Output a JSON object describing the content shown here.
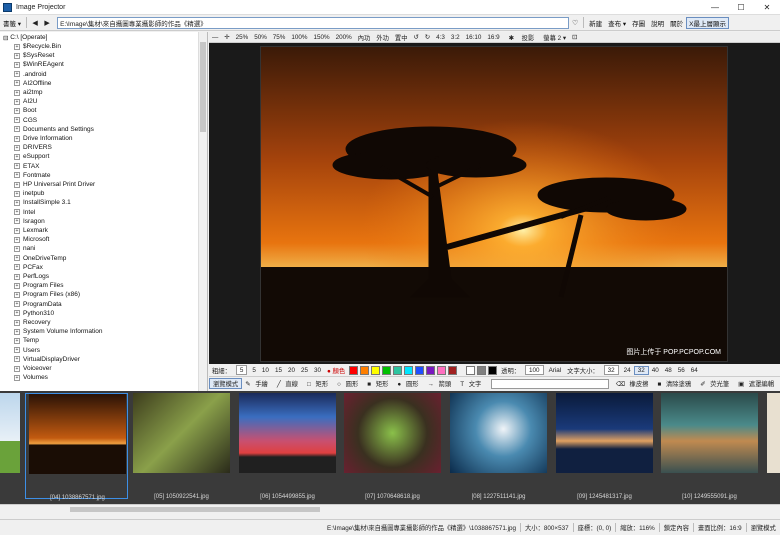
{
  "window": {
    "title": "Image Projector",
    "min": "—",
    "max": "☐",
    "close": "✕"
  },
  "toolbar": {
    "bookmarks": "書籤 ▾",
    "back": "◀",
    "forward": "▶",
    "address": "E:\\Image\\集材\\來自攝圖專業攝影師的作品《精選》",
    "items": [
      "新建",
      "查布 ▾",
      "存圖",
      "說明",
      "關於"
    ],
    "fullscreen": "X最上層顯示"
  },
  "viewer_toolbar": {
    "items": [
      "25%",
      "50%",
      "75%",
      "100%",
      "150%",
      "200%",
      "內功",
      "外功",
      "置中",
      "↺",
      "↻",
      "4:3",
      "3:2",
      "16:10",
      "16:9"
    ],
    "slideshow": "投影",
    "screen": "螢幕 2 ▾"
  },
  "tree": {
    "root": "C:\\ [Operate]",
    "items": [
      "$Recycle.Bin",
      "$SysReset",
      "$WinREAgent",
      ".android",
      "AI2Offline",
      "ai2tmp",
      "AI2U",
      "Boot",
      "CGS",
      "Documents and Settings",
      "Drive Information",
      "DRIVERS",
      "eSupport",
      "ETAX",
      "Fontmate",
      "HP Universal Print Driver",
      "inetpub",
      "InstallSimple 3.1",
      "Intel",
      "Isragon",
      "Lexmark",
      "Microsoft",
      "nani",
      "OneDriveTemp",
      "PCFax",
      "PerfLogs",
      "Program Files",
      "Program Files (x86)",
      "ProgramData",
      "Python310",
      "Recovery",
      "System Volume Information",
      "Temp",
      "Users",
      "VirtualDisplayDriver",
      "Voiceover",
      "Volumes"
    ]
  },
  "main_image": {
    "watermark": "图片上传于 POP.PCPOP.COM"
  },
  "drawbar": {
    "thickness_label": "粗細：",
    "thickness_value": "5",
    "sizes": [
      "5",
      "10",
      "15",
      "20",
      "25",
      "30"
    ],
    "color_label": "● 顏色",
    "colors": [
      "#ff0000",
      "#ff7f00",
      "#ffff00",
      "#00c000",
      "#2ec4a0",
      "#00e5ff",
      "#1f4fff",
      "#7a18c0",
      "#ff70c0",
      "#a02020",
      "#ffffff",
      "#808080",
      "#000000"
    ],
    "opacity_label": "透明：",
    "opacity_value": "100",
    "font": "Arial",
    "fontsize_label": "文字大小：",
    "fontsize_value": "32",
    "fontsizes": [
      "24",
      "32",
      "40",
      "48",
      "56",
      "64"
    ]
  },
  "modebar": {
    "items": [
      "瀏覽模式",
      "手繪",
      "直線",
      "矩形",
      "圓形",
      "矩形",
      "圓形",
      "箭頭",
      "文字"
    ],
    "right": [
      "橡皮擦",
      "清除塗鴉",
      "荧光筆",
      "遮罩編輯"
    ]
  },
  "thumbnails": [
    {
      "caption": ""
    },
    {
      "caption": "[04] 1038867571.jpg"
    },
    {
      "caption": "[05] 1050922541.jpg"
    },
    {
      "caption": "[06] 1054499855.jpg"
    },
    {
      "caption": "[07] 1070648618.jpg"
    },
    {
      "caption": "[08] 1227511141.jpg"
    },
    {
      "caption": "[09] 1245481317.jpg"
    },
    {
      "caption": "[10] 1249555091.jpg"
    }
  ],
  "status": {
    "path": "E:\\Image\\集材\\來自攝圖專業攝影師的作品《精選》\\1038867571.jpg",
    "size": "大小：800×537",
    "coord": "座標：(0, 0)",
    "zoom": "縮放：116%",
    "fit": "鎖定內容",
    "ratio": "畫面比例：16:9",
    "mode": "瀏覽模式"
  }
}
